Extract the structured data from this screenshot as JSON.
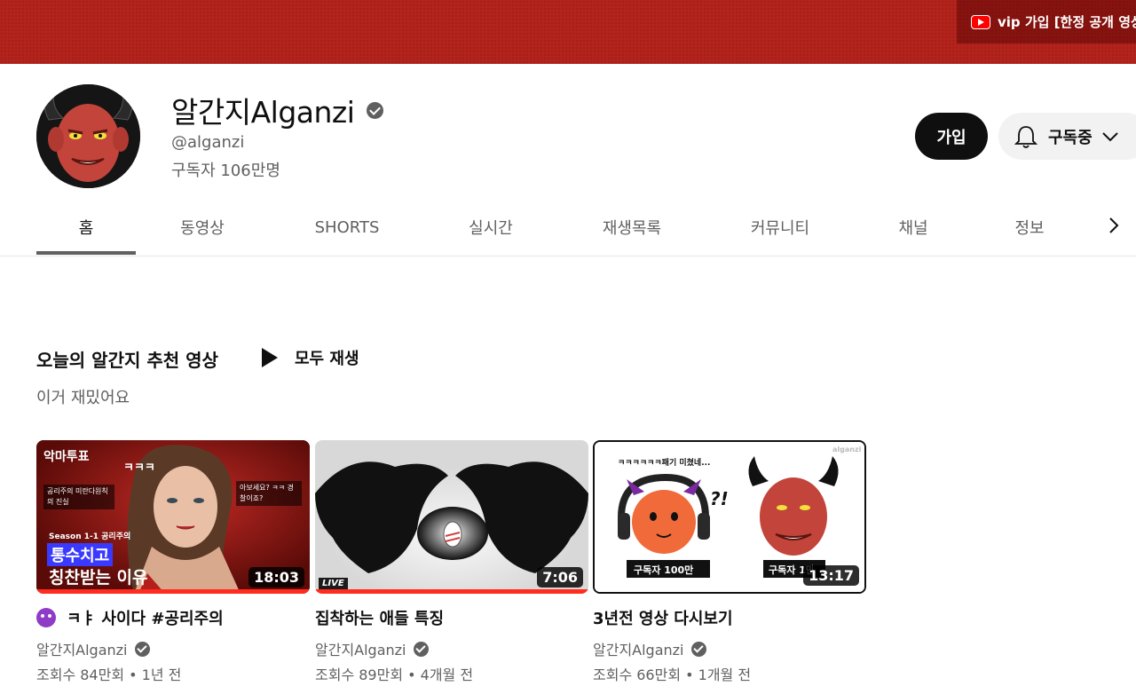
{
  "banner": {
    "link_text": "vip 가입 [한정 공개 영상"
  },
  "channel": {
    "name": "알간지Alganzi",
    "handle": "@alganzi",
    "subscribers": "구독자 106만명",
    "join_label": "가입",
    "subscribed_label": "구독중"
  },
  "tabs": [
    {
      "label": "홈",
      "active": true
    },
    {
      "label": "동영상"
    },
    {
      "label": "SHORTS"
    },
    {
      "label": "실시간"
    },
    {
      "label": "재생목록"
    },
    {
      "label": "커뮤니티"
    },
    {
      "label": "채널"
    },
    {
      "label": "정보"
    }
  ],
  "shelf": {
    "title": "오늘의 알간지 추천 영상",
    "play_all": "모두 재생",
    "subtitle": "이거 재밌어요"
  },
  "videos": [
    {
      "title": "ㅋㅑ 사이다 #공리주의",
      "emoji": "smiling-devil-emoji",
      "channel": "알간지Alganzi",
      "meta": "조회수 84만회 • 1년 전",
      "duration": "18:03",
      "watched_fraction": 1.0,
      "thumb_texts": {
        "brand": "악마투표",
        "laugh": "ㅋㅋㅋ",
        "season": "Season 1-1 공리주의",
        "line1": "통수치고",
        "line2": "칭찬받는 이유",
        "note_left": "공리주의 미란다원칙의 진실",
        "note_right": "아보세요? ㅋㅋ 경찰이죠?"
      }
    },
    {
      "title": "집착하는 애들 특징",
      "channel": "알간지Alganzi",
      "meta": "조회수 89만회 • 4개월 전",
      "duration": "7:06",
      "watched_fraction": 1.0,
      "live_label": "LIVE"
    },
    {
      "title": "3년전 영상 다시보기",
      "channel": "알간지Alganzi",
      "meta": "조회수 66만회 • 1개월 전",
      "duration": "13:17",
      "watched_fraction": 0,
      "thumb_texts": {
        "top": "ㅋㅋㅋㅋㅋㅋ패기 미쳤네...",
        "mark": "?!",
        "label_left": "구독자 100만",
        "label_right": "구독자 1만",
        "wm": "alganzi"
      }
    }
  ],
  "colors": {
    "banner": "#b3231c",
    "progress": "#ff2c1f",
    "text_secondary": "#606060"
  }
}
